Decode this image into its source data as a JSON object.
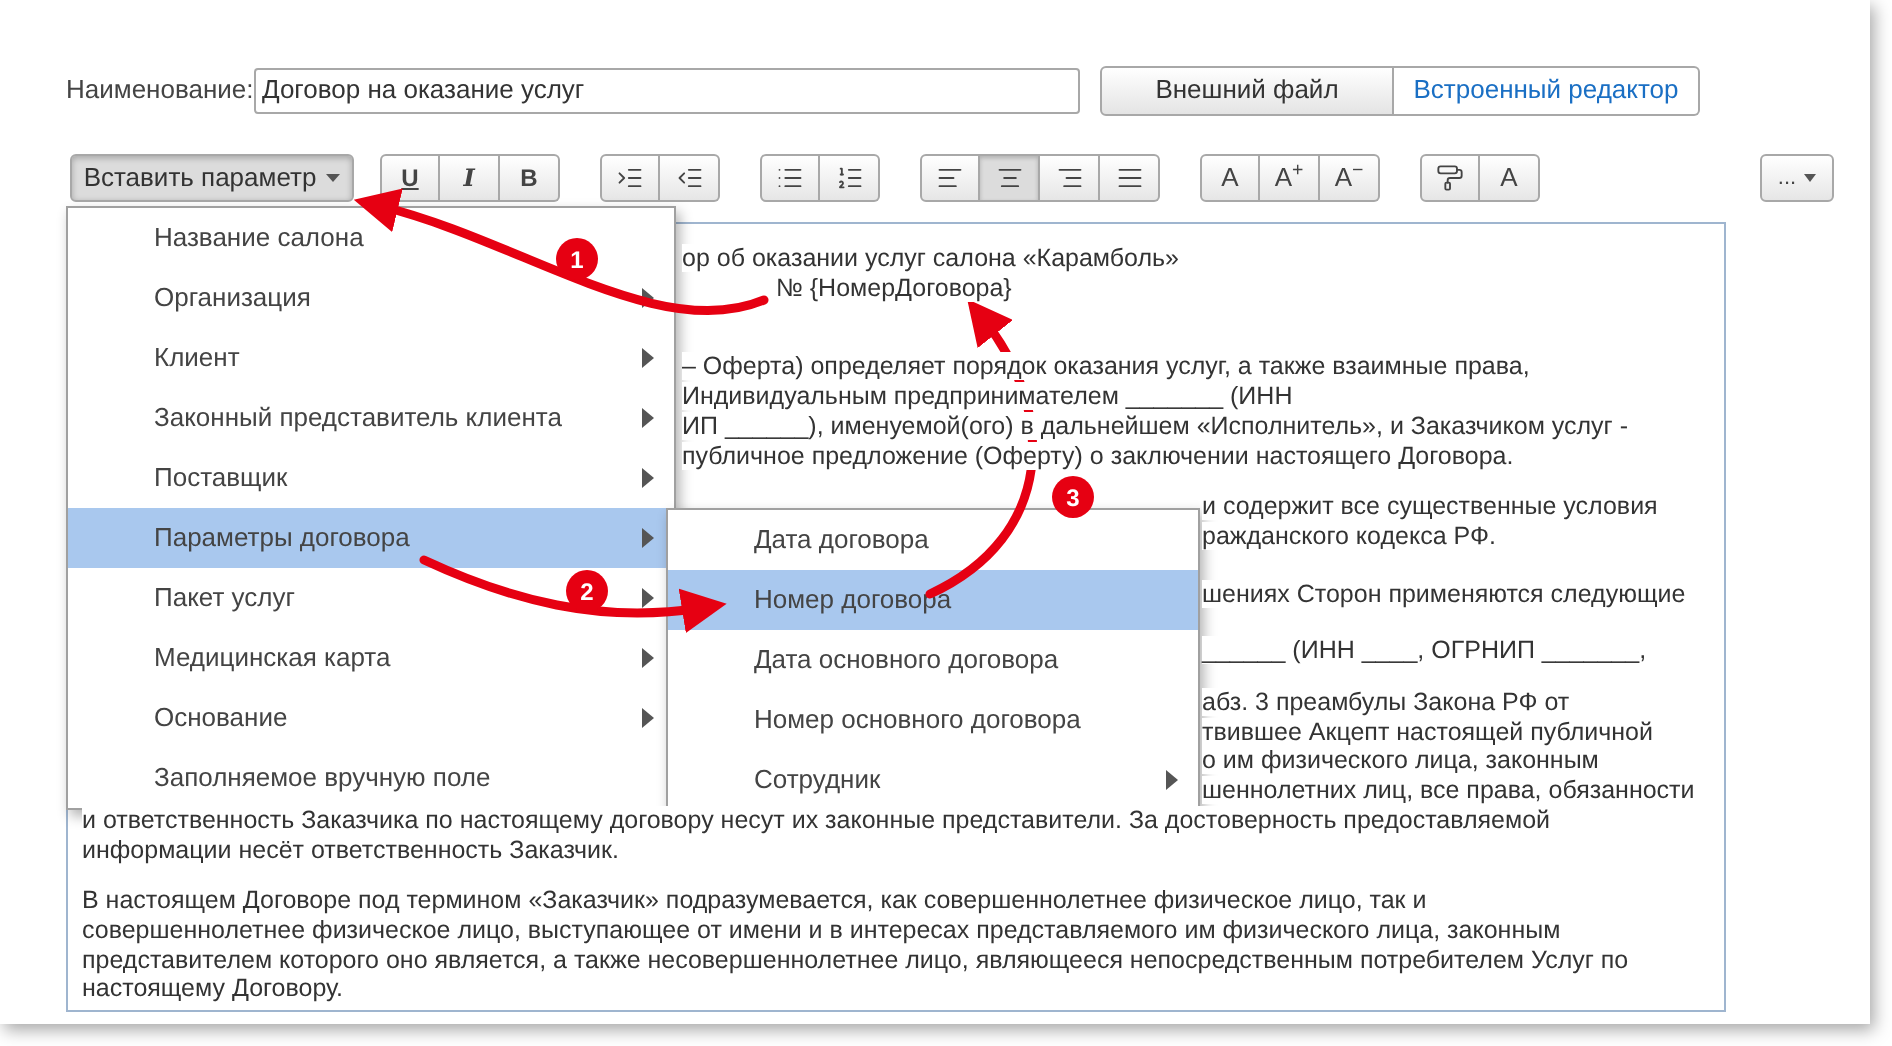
{
  "name_field": {
    "label": "Наименование:",
    "value": "Договор на оказание услуг"
  },
  "source_tabs": [
    {
      "label": "Внешний файл",
      "selected": false
    },
    {
      "label": "Встроенный редактор",
      "selected": true
    }
  ],
  "insert_button": {
    "label": "Вставить параметр",
    "open": true
  },
  "toolbar_groups": [
    [
      {
        "kind": "underline",
        "label": "U",
        "selected": false
      },
      {
        "kind": "italic",
        "label": "I",
        "selected": false
      },
      {
        "kind": "bold",
        "label": "B",
        "selected": false
      }
    ],
    [
      {
        "kind": "indent-increase",
        "selected": false
      },
      {
        "kind": "indent-decrease",
        "selected": false
      }
    ],
    [
      {
        "kind": "bullet-list",
        "selected": false
      },
      {
        "kind": "numbered-list",
        "selected": false
      }
    ],
    [
      {
        "kind": "align-left",
        "selected": false
      },
      {
        "kind": "align-center",
        "selected": true
      },
      {
        "kind": "align-right",
        "selected": false
      },
      {
        "kind": "align-justify",
        "selected": false
      }
    ],
    [
      {
        "kind": "glyph",
        "label": "A",
        "selected": false
      },
      {
        "kind": "glyph",
        "label": "A$^{+}$",
        "selected": false
      },
      {
        "kind": "glyph",
        "label": "A$^{−}$",
        "selected": false
      }
    ],
    [
      {
        "kind": "format-painter",
        "selected": false
      },
      {
        "kind": "glyph",
        "label": "A",
        "selected": false
      }
    ]
  ],
  "more_button": {
    "label": "..."
  },
  "document": [
    {
      "lines": [
        {
          "kind": "after_menu",
          "text": "ор об оказании услуг салона «Карамболь»"
        },
        {
          "kind": "center",
          "text": "№ {НомерДоговора}"
        }
      ]
    },
    {
      "lines": [
        {
          "kind": "after_menu",
          "text": "– Оферта) определяет порядок оказания услуг, а также взаимные права,"
        },
        {
          "kind": "after_menu",
          "text": "Индивидуальным предпринимателем _______ (ИНН"
        },
        {
          "kind": "after_menu",
          "text": "ИП ______), именуемой(ого) в дальнейшем «Исполнитель», и Заказчиком услуг -"
        },
        {
          "kind": "after_menu",
          "text": "публичное предложение (Оферту) о заключении настоящего Договора."
        }
      ]
    },
    {
      "lines": [
        {
          "kind": "after_submenu",
          "text": "и содержит все существенные условия"
        },
        {
          "kind": "after_submenu",
          "text": "ражданского кодекса РФ."
        }
      ]
    },
    {
      "lines": [
        {
          "kind": "after_submenu",
          "text": "шениях Сторон применяются следующие"
        }
      ]
    },
    {
      "lines": [
        {
          "kind": "after_submenu",
          "text": "______ (ИНН ____, ОГРНИП _______,"
        }
      ]
    },
    {
      "lines": [
        {
          "kind": "after_submenu",
          "text": "абз. 3 преамбулы Закона РФ от"
        },
        {
          "kind": "after_submenu",
          "text": "твившее Акцепт настоящей публичной"
        },
        {
          "kind": "after_submenu",
          "text": "о им физического лица, законным"
        },
        {
          "kind": "after_submenu",
          "text": "шеннолетних лиц, все права, обязанности"
        },
        {
          "kind": "full",
          "text": "и ответственность Заказчика по настоящему договору несут их законные представители. За достоверность предоставляемой"
        },
        {
          "kind": "full",
          "text": "информации несёт ответственность Заказчик."
        }
      ]
    },
    {
      "lines": [
        {
          "kind": "full",
          "text": "В настоящем Договоре под термином «Заказчик» подразумевается, как совершеннолетнее физическое лицо, так и"
        },
        {
          "kind": "full",
          "text": "совершеннолетнее физическое лицо, выступающее от имени и в интересах представляемого им физического лица, законным"
        },
        {
          "kind": "full",
          "text": "представителем которого оно является, а также несовершеннолетнее лицо, являющееся непосредственным потребителем Услуг по"
        },
        {
          "kind": "full",
          "text": "настоящему Договору."
        }
      ]
    }
  ],
  "menu": [
    {
      "label": "Название салона",
      "submenu": false,
      "selected": false
    },
    {
      "label": "Организация",
      "submenu": true,
      "selected": false
    },
    {
      "label": "Клиент",
      "submenu": true,
      "selected": false
    },
    {
      "label": "Законный представитель клиента",
      "submenu": true,
      "selected": false
    },
    {
      "label": "Поставщик",
      "submenu": true,
      "selected": false
    },
    {
      "label": "Параметры договора",
      "submenu": true,
      "selected": true
    },
    {
      "label": "Пакет услуг",
      "submenu": true,
      "selected": false
    },
    {
      "label": "Медицинская карта",
      "submenu": true,
      "selected": false
    },
    {
      "label": "Основание",
      "submenu": true,
      "selected": false
    },
    {
      "label": "Заполняемое вручную поле",
      "submenu": false,
      "selected": false
    }
  ],
  "submenu": [
    {
      "label": "Дата договора",
      "submenu": false,
      "selected": false
    },
    {
      "label": "Номер договора",
      "submenu": false,
      "selected": true
    },
    {
      "label": "Дата основного договора",
      "submenu": false,
      "selected": false
    },
    {
      "label": "Номер основного договора",
      "submenu": false,
      "selected": false
    },
    {
      "label": "Сотрудник",
      "submenu": true,
      "selected": false
    }
  ],
  "annotations": [
    {
      "label": "1"
    },
    {
      "label": "2"
    },
    {
      "label": "3"
    }
  ]
}
